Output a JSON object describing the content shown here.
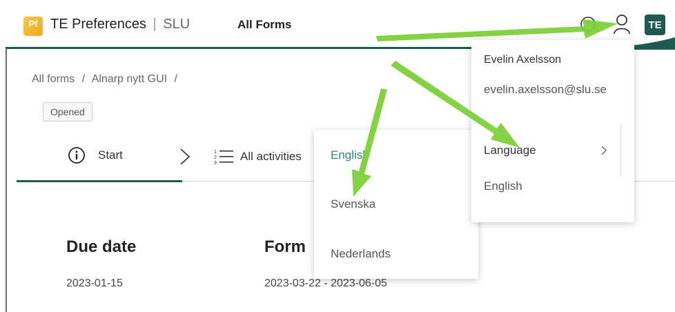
{
  "header": {
    "logo_text": "Pf",
    "app_name": "TE Preferences",
    "app_separator": "|",
    "app_org": "SLU",
    "nav_all_forms": "All Forms",
    "avatar_initials": "TE",
    "accent_color": "#1e5a52"
  },
  "breadcrumb": {
    "items": [
      "All forms",
      "/",
      "Alnarp nytt GUI",
      "/"
    ]
  },
  "status_badge": "Opened",
  "tabs": {
    "start_label": "Start",
    "activities_label": "All activities"
  },
  "form_info": {
    "due_title": "Due date",
    "due_value": "2023-01-15",
    "form_title": "Form",
    "form_value": "2023-03-22 - 2023-06-05"
  },
  "user_menu": {
    "name": "Evelin Axelsson",
    "email": "evelin.axelsson@slu.se",
    "language_label": "Language",
    "current_language": "English"
  },
  "language_menu": {
    "options": [
      "English",
      "Svenska",
      "Nederlands"
    ],
    "selected_color": "#2d8a78"
  },
  "annotation": {
    "arrow_color": "#7ed03a"
  }
}
